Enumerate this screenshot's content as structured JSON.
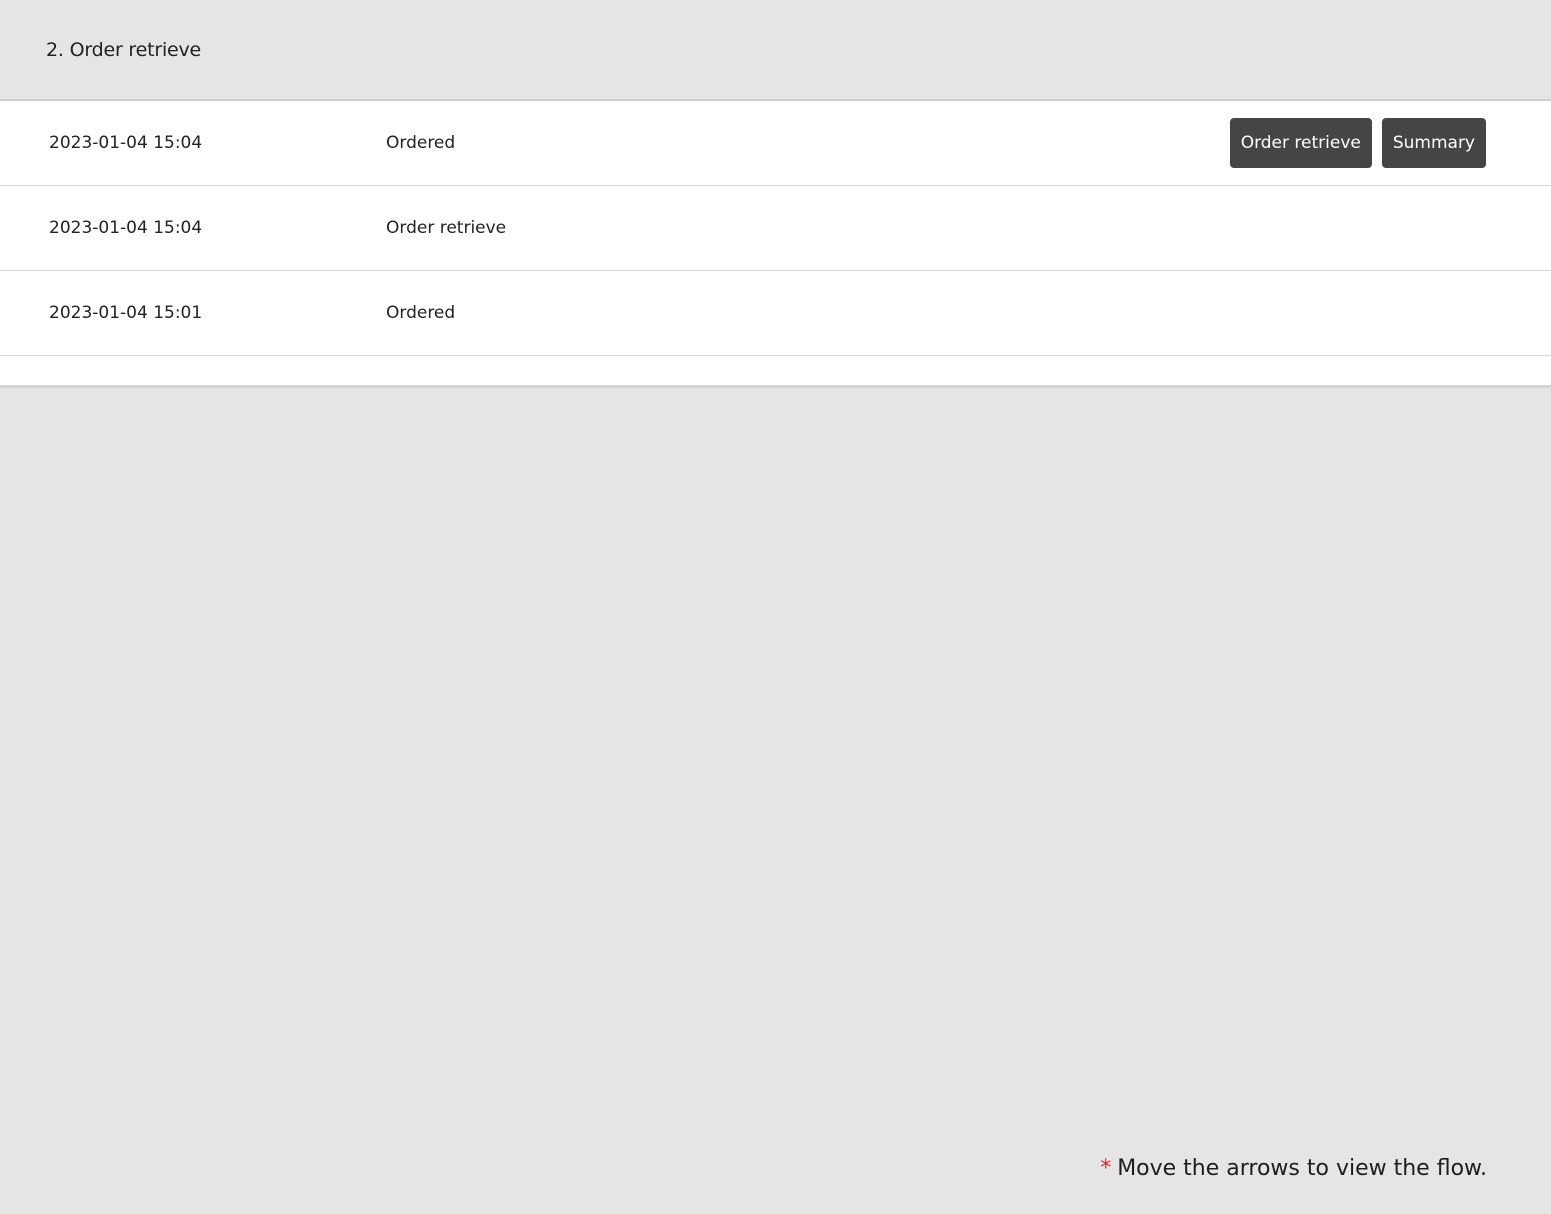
{
  "section": {
    "title": "2. Order retrieve"
  },
  "history": {
    "rows": [
      {
        "date": "2023-01-04 15:04",
        "status": "Ordered"
      },
      {
        "date": "2023-01-04 15:04",
        "status": "Order retrieve"
      },
      {
        "date": "2023-01-04 15:01",
        "status": "Ordered"
      }
    ],
    "actions": {
      "order_retrieve_label": "Order retrieve",
      "summary_label": "Summary"
    }
  },
  "footnote": {
    "marker": "*",
    "text": "Move the arrows to view the flow."
  },
  "colors": {
    "background": "#e5e5e5",
    "button": "#454545",
    "asterisk": "#e0292a"
  }
}
